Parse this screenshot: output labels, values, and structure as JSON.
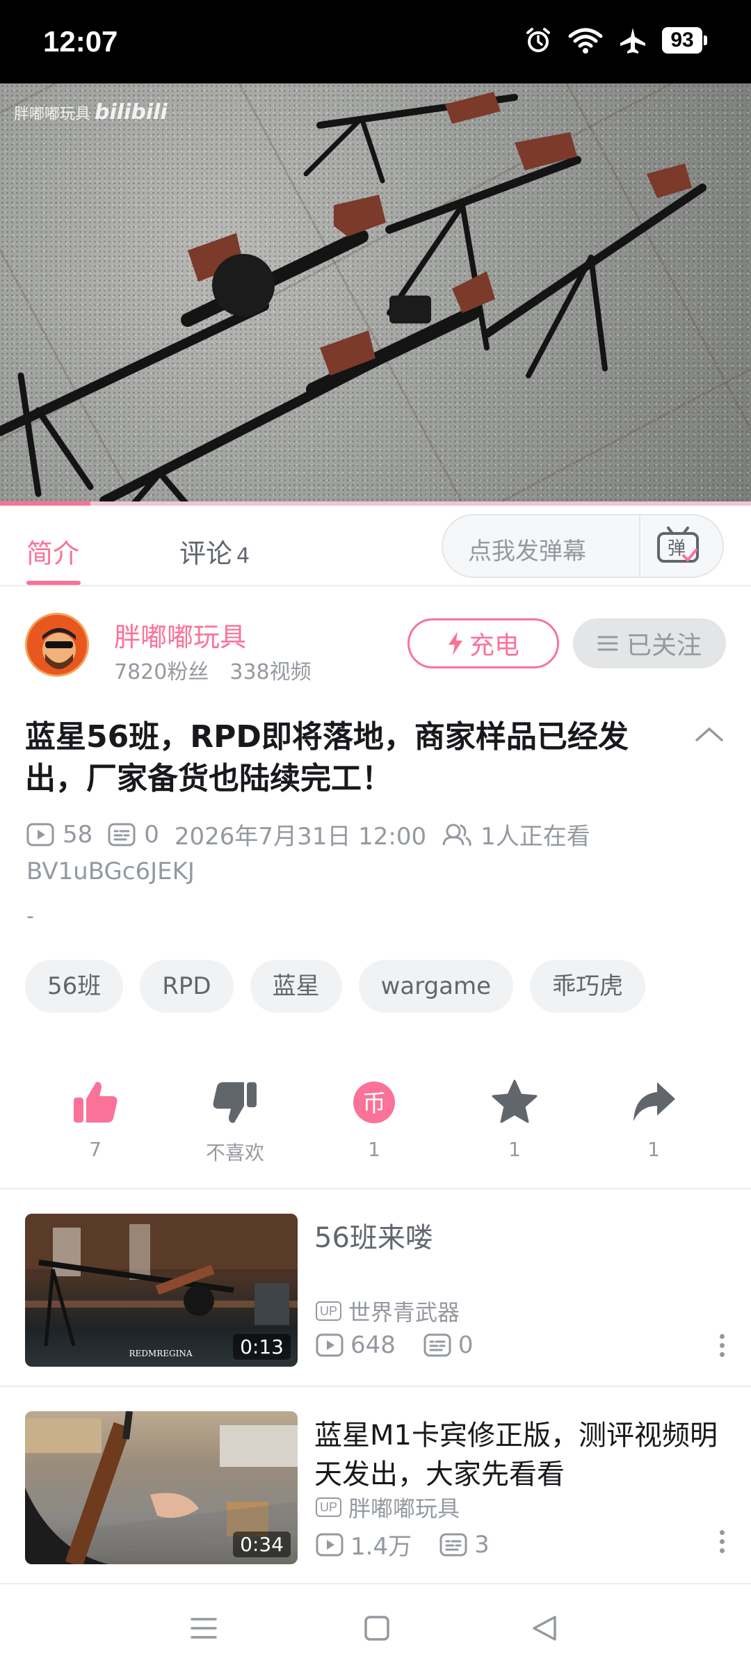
{
  "status_bar": {
    "time": "12:07",
    "battery": "93"
  },
  "video": {
    "watermark_channel": "胖嘟嘟玩具",
    "watermark_brand": "bilibili",
    "progress_fraction": 0.12
  },
  "tabs": {
    "intro": "简介",
    "comments": "评论",
    "comments_count": "4",
    "danmaku_placeholder": "点我发弹幕",
    "danmaku_icon_label": "弹"
  },
  "uploader": {
    "name": "胖嘟嘟玩具",
    "fans": "7820粉丝",
    "videos": "338视频",
    "charge_label": "充电",
    "follow_label": "已关注"
  },
  "video_info": {
    "title": "蓝星56班，RPD即将落地，商家样品已经发出，厂家备货也陆续完工！",
    "plays": "58",
    "danmaku_count": "0",
    "date": "2026年7月31日 12:00",
    "watching": "1人正在看",
    "bvid": "BV1uBGc6JEKJ",
    "description": "-"
  },
  "tags": [
    "56班",
    "RPD",
    "蓝星",
    "wargame",
    "乖巧虎"
  ],
  "actions": {
    "like": "7",
    "dislike": "不喜欢",
    "coin": "1",
    "coin_icon_label": "币",
    "favorite": "1",
    "share": "1"
  },
  "related": [
    {
      "title": "56班来喽",
      "uploader": "世界青武器",
      "duration": "0:13",
      "plays": "648",
      "danmaku": "0",
      "thumb_caption": "REDMREGINA"
    },
    {
      "title": "蓝星M1卡宾修正版，测评视频明天发出，大家先看看",
      "uploader": "胖嘟嘟玩具",
      "duration": "0:34",
      "plays": "1.4万",
      "danmaku": "3"
    }
  ],
  "up_badge": "UP",
  "colors": {
    "accent": "#fb7299",
    "text_secondary": "#9499a0",
    "divider": "#ececec"
  },
  "icons": [
    "alarm-icon",
    "wifi-icon",
    "airplane-icon",
    "battery-icon",
    "danmaku-icon",
    "lightning-icon",
    "menu-lines-icon",
    "play-icon",
    "danmaku-count-icon",
    "viewers-icon",
    "chevron-up-icon",
    "thumbs-up-icon",
    "thumbs-down-icon",
    "coin-icon",
    "star-icon",
    "share-icon",
    "more-icon",
    "nav-menu-icon",
    "nav-home-icon",
    "nav-back-icon"
  ]
}
